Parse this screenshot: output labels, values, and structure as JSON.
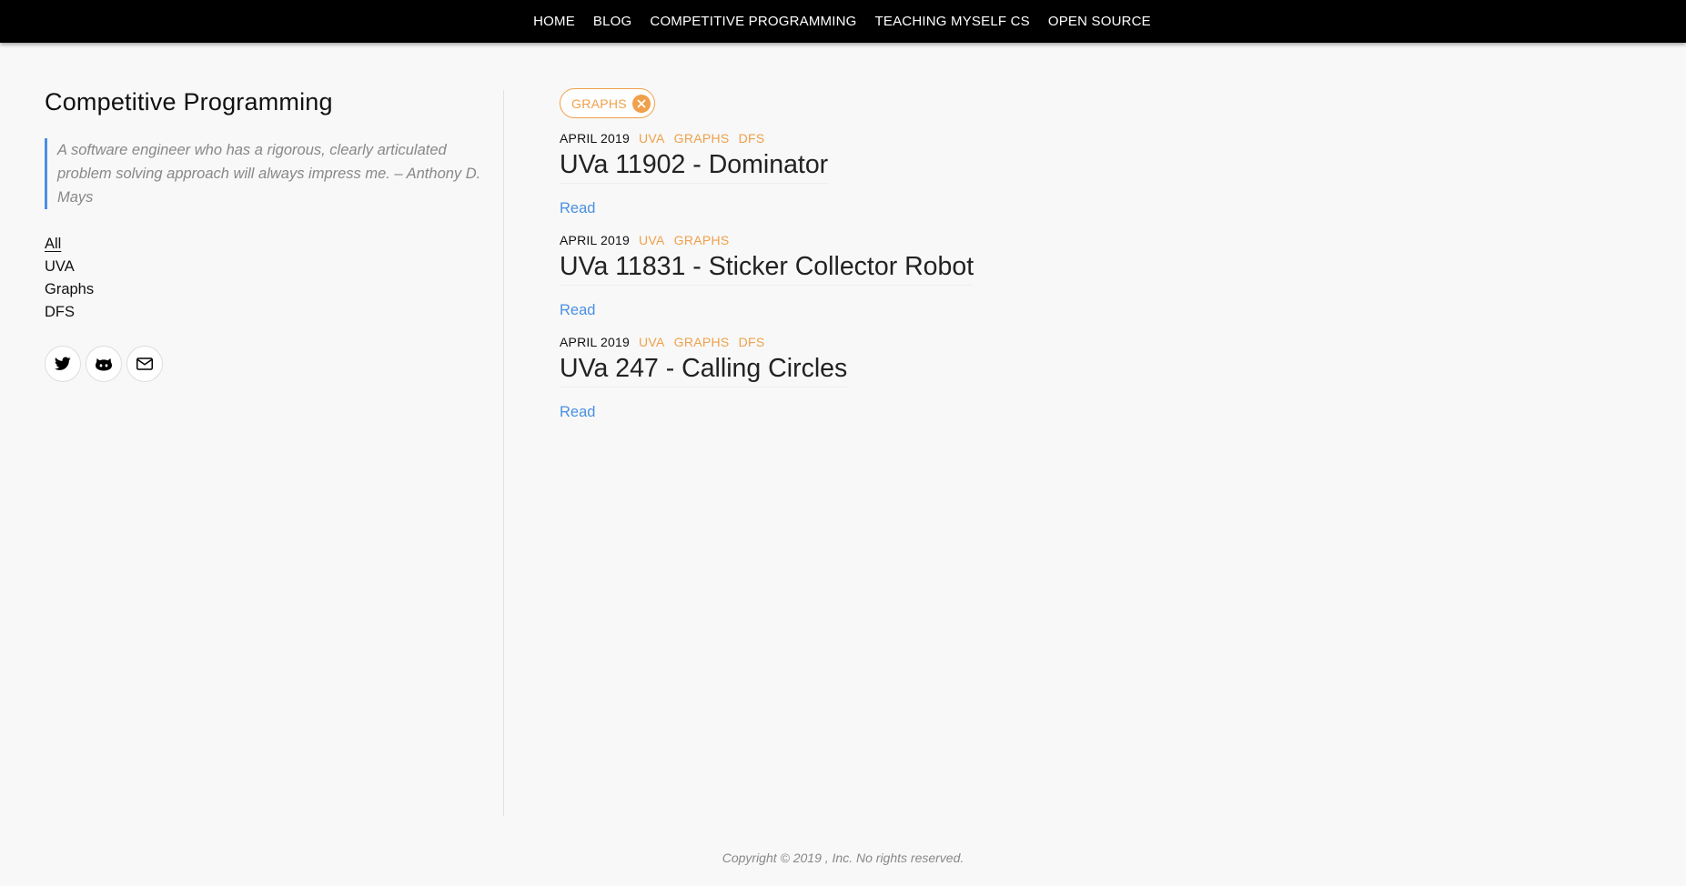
{
  "nav": {
    "items": [
      {
        "label": "HOME"
      },
      {
        "label": "BLOG"
      },
      {
        "label": "COMPETITIVE PROGRAMMING"
      },
      {
        "label": "TEACHING MYSELF CS"
      },
      {
        "label": "OPEN SOURCE"
      }
    ]
  },
  "sidebar": {
    "title": "Competitive Programming",
    "quote": "A software engineer who has a rigorous, clearly articulated problem solving approach will always impress me. – Anthony D. Mays",
    "categories": [
      {
        "label": "All",
        "active": true
      },
      {
        "label": "UVA"
      },
      {
        "label": "Graphs"
      },
      {
        "label": "DFS"
      }
    ],
    "social": [
      {
        "icon": "twitter-icon"
      },
      {
        "icon": "github-icon"
      },
      {
        "icon": "email-icon"
      }
    ]
  },
  "filter": {
    "label": "GRAPHS",
    "color": "#f0a04b"
  },
  "posts": [
    {
      "date": "APRIL 2019",
      "tags": [
        "UVA",
        "GRAPHS",
        "DFS"
      ],
      "title": "UVa 11902 - Dominator",
      "read_label": "Read"
    },
    {
      "date": "APRIL 2019",
      "tags": [
        "UVA",
        "GRAPHS"
      ],
      "title": "UVa 11831 - Sticker Collector Robot",
      "read_label": "Read"
    },
    {
      "date": "APRIL 2019",
      "tags": [
        "UVA",
        "GRAPHS",
        "DFS"
      ],
      "title": "UVa 247 - Calling Circles",
      "read_label": "Read"
    }
  ],
  "footer": {
    "copyright": "Copyright © 2019 , Inc. No rights reserved."
  },
  "colors": {
    "accent_orange": "#f0a04b",
    "link_blue": "#4a90e2",
    "nav_bg": "#000000"
  }
}
